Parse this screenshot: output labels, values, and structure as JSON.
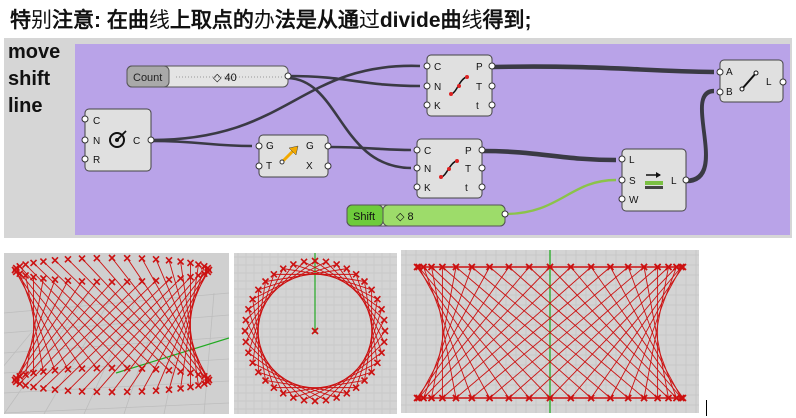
{
  "title": {
    "seg1": "特",
    "seg2": "别",
    "seg3": "注意: 在曲",
    "seg4": "线",
    "seg5": "上取点的",
    "seg6": "办",
    "seg7": "法是从通",
    "seg8": "过",
    "seg9": "divide曲",
    "seg10": "线",
    "seg11": "得到;"
  },
  "side_labels": [
    "move",
    "shift",
    "line"
  ],
  "components": {
    "count_slider": {
      "label": "Count",
      "value": "◇ 40"
    },
    "shift_slider": {
      "label": "Shift",
      "value": "◇ 8"
    },
    "circle": {
      "inputs": [
        "C",
        "N",
        "R"
      ],
      "outputs": [
        "C"
      ]
    },
    "move": {
      "inputs": [
        "G",
        "T"
      ],
      "outputs": [
        "G",
        "X"
      ]
    },
    "divide_top": {
      "inputs": [
        "C",
        "N",
        "K"
      ],
      "outputs": [
        "P",
        "T",
        "t"
      ]
    },
    "divide_bottom": {
      "inputs": [
        "C",
        "N",
        "K"
      ],
      "outputs": [
        "P",
        "T",
        "t"
      ]
    },
    "shift_list": {
      "inputs": [
        "L",
        "S",
        "W"
      ],
      "outputs": [
        "L"
      ]
    },
    "line": {
      "inputs": [
        "A",
        "B"
      ],
      "outputs": [
        "L"
      ]
    }
  },
  "colors": {
    "canvas": "#b9a3e8",
    "component": "#e0e0e0",
    "slider_count": "#a9a9a9",
    "slider_shift": "#6ecb3c",
    "wire": "#3a3a44",
    "wire_green": "#8bc34a",
    "geometry": "#cc1111",
    "axis_green": "#22aa22"
  }
}
